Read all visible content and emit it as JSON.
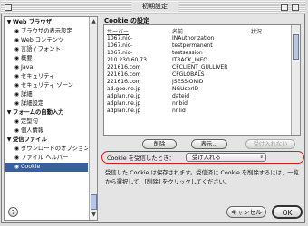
{
  "window": {
    "title": "初期設定"
  },
  "sidebar": {
    "items": [
      {
        "label": "Web ブラウザ",
        "kind": "cat",
        "glyph": "▼"
      },
      {
        "label": "ブラウザの表示設定",
        "kind": "child",
        "glyph": "◉"
      },
      {
        "label": "Web コンテンツ",
        "kind": "child",
        "glyph": "◉"
      },
      {
        "label": "言語 / フォント",
        "kind": "child",
        "glyph": "◉"
      },
      {
        "label": "概要",
        "kind": "child",
        "glyph": "◉"
      },
      {
        "label": "Java",
        "kind": "child",
        "glyph": "◉"
      },
      {
        "label": "セキュリティ",
        "kind": "child",
        "glyph": "◉"
      },
      {
        "label": "セキュリティ ゾーン",
        "kind": "child",
        "glyph": "◉"
      },
      {
        "label": "詳細",
        "kind": "child",
        "glyph": "◉"
      },
      {
        "label": "詳細設定",
        "kind": "child",
        "glyph": "◉"
      },
      {
        "label": "フォームの自動入力",
        "kind": "cat",
        "glyph": "▼"
      },
      {
        "label": "定型句",
        "kind": "child",
        "glyph": "◉"
      },
      {
        "label": "個人情報",
        "kind": "child",
        "glyph": "◉"
      },
      {
        "label": "受信ファイル",
        "kind": "cat",
        "glyph": "▼"
      },
      {
        "label": "ダウンロードのオプション",
        "kind": "child",
        "glyph": "◉"
      },
      {
        "label": "ファイル ヘルパー",
        "kind": "child",
        "glyph": "◉"
      },
      {
        "label": "Cookie",
        "kind": "child",
        "glyph": "◉",
        "selected": true
      }
    ]
  },
  "cookie_panel": {
    "title": "Cookie の設定",
    "columns": [
      "サーバー",
      "名前",
      "状況"
    ],
    "rows": [
      [
        "1067.nic-",
        "INAuthorization",
        ""
      ],
      [
        "1067.nic-",
        "testpermanent",
        ""
      ],
      [
        "1067.nic-",
        "testsession",
        ""
      ],
      [
        "210.230.60.73",
        "ITRACK_INFO",
        ""
      ],
      [
        "221616.com",
        "CFCLIENT_GULLIVER",
        ""
      ],
      [
        "221616.com",
        "CFGLOBALS",
        ""
      ],
      [
        "221616.com",
        "JSESSIONID",
        ""
      ],
      [
        "ad.goo.ne.jp",
        "NGUserID",
        ""
      ],
      [
        "adplan.ne.jp",
        "dateid",
        ""
      ],
      [
        "adplan.ne.jp",
        "nnbid",
        ""
      ],
      [
        "adplan.ne.jp",
        "nnlid",
        ""
      ]
    ],
    "buttons": {
      "delete": "削除",
      "view": "表示...",
      "never": "受け入れない"
    },
    "accept_label": "Cookie を受信したとき：",
    "accept_value": "受け入れる",
    "description": "受信した Cookie は保存されます。受信済に Cookie を削除するには、一覧から選択して、[削除] をクリックしてください。"
  },
  "footer": {
    "help": "?",
    "cancel": "キャンセル",
    "ok": "OK"
  }
}
